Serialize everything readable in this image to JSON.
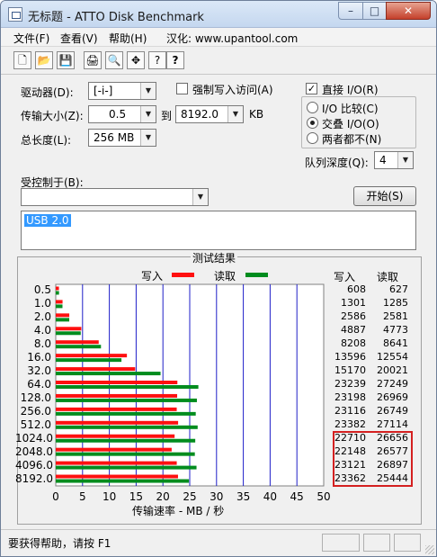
{
  "window": {
    "title": "无标题 - ATTO Disk Benchmark",
    "controls": {
      "minimize": "–",
      "maximize": "□",
      "close": "✕"
    }
  },
  "menu": [
    {
      "label": "文件(F)"
    },
    {
      "label": "查看(V)"
    },
    {
      "label": "帮助(H)"
    },
    {
      "label": "汉化: www.upantool.com"
    }
  ],
  "toolbar": {
    "buttons": [
      {
        "icon": "new-document-icon",
        "glyph": "🗋"
      },
      {
        "icon": "open-folder-icon",
        "glyph": "📂"
      },
      {
        "icon": "save-icon",
        "glyph": "💾"
      },
      {
        "icon": "print-icon",
        "glyph": "🖨"
      },
      {
        "icon": "print-preview-icon",
        "glyph": "🔍"
      },
      {
        "icon": "move-icon",
        "glyph": "✥"
      },
      {
        "icon": "help-icon",
        "glyph": "?"
      },
      {
        "icon": "context-help-icon",
        "glyph": "?"
      }
    ]
  },
  "settings": {
    "drive_label": "驱动器(D):",
    "drive_value": "[-i-]",
    "force_write_label": "强制写入访问(A)",
    "force_write_checked": false,
    "transfer_size_label": "传输大小(Z):",
    "transfer_from": "0.5",
    "to_label": "到",
    "transfer_to": "8192.0",
    "kb_label": "KB",
    "total_length_label": "总长度(L):",
    "total_length_value": "256 MB",
    "direct_io_label": "直接 I/O(R)",
    "direct_io_checked": true,
    "check_mark": "✓",
    "io_options": [
      {
        "label": "I/O 比较(C)",
        "selected": false
      },
      {
        "label": "交叠 I/O(O)",
        "selected": true
      },
      {
        "label": "两者都不(N)",
        "selected": false
      }
    ],
    "queue_depth_label": "队列深度(Q):",
    "queue_depth_value": "4",
    "controlled_by_label": "受控制于(B):",
    "controlled_by_value": "",
    "start_button": "开始(S)",
    "description_text": "USB 2.0"
  },
  "results": {
    "group_title": "测试结果",
    "write_legend": "写入",
    "read_legend": "读取",
    "write_color": "#ff1010",
    "read_color": "#008c1e",
    "write_col_header": "写入",
    "read_col_header": "读取",
    "x_axis_label": "传输速率 - MB / 秒",
    "highlight_color": "#d42020"
  },
  "chart_data": {
    "type": "bar",
    "orientation": "horizontal",
    "categories": [
      "0.5",
      "1.0",
      "2.0",
      "4.0",
      "8.0",
      "16.0",
      "32.0",
      "64.0",
      "128.0",
      "256.0",
      "512.0",
      "1024.0",
      "2048.0",
      "4096.0",
      "8192.0"
    ],
    "series": [
      {
        "name": "写入",
        "values": [
          608,
          1301,
          2586,
          4887,
          8208,
          13596,
          15170,
          23239,
          23198,
          23116,
          23382,
          22710,
          22148,
          23121,
          23362
        ]
      },
      {
        "name": "读取",
        "values": [
          627,
          1285,
          2581,
          4773,
          8641,
          12554,
          20021,
          27249,
          26969,
          26749,
          27114,
          26656,
          26577,
          26897,
          25444
        ]
      }
    ],
    "xlabel": "传输速率 - MB / 秒",
    "xlim": [
      0,
      50
    ],
    "x_ticks": [
      "0",
      "5",
      "10",
      "15",
      "20",
      "25",
      "30",
      "35",
      "40",
      "45",
      "50"
    ],
    "grid": true,
    "legend_position": "top"
  },
  "status": {
    "help_text": "要获得帮助，请按 F1"
  }
}
